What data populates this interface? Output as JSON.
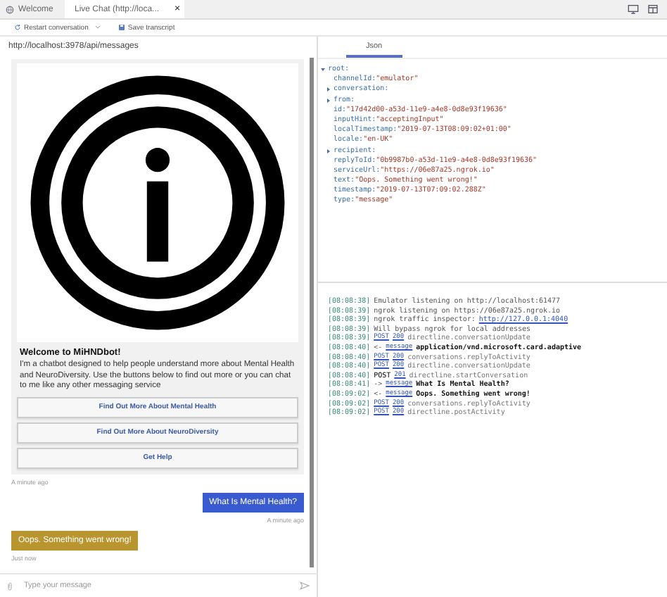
{
  "tabs": [
    {
      "label": "Welcome",
      "selected": false,
      "closable": false
    },
    {
      "label": "Live Chat (http://loca...",
      "selected": true,
      "closable": true
    }
  ],
  "tab_close": "×",
  "toolbar": {
    "restart": "Restart conversation",
    "save": "Save transcript"
  },
  "chat": {
    "url": "http://localhost:3978/api/messages",
    "card": {
      "title": "Welcome to MiHNDbot!",
      "text": "I'm a chatbot designed to help people understand more about Mental Health and NeuroDiversity. Use the buttons below to find out more or you can chat to me like any other messaging service",
      "buttons": [
        "Find Out More About Mental Health",
        "Find Out More About NeuroDiversity",
        "Get Help"
      ],
      "time": "A minute ago"
    },
    "messages": [
      {
        "kind": "sent",
        "text": "What Is Mental Health?",
        "time": "A minute ago"
      },
      {
        "kind": "received",
        "text": "Oops. Something went wrong!",
        "time": "Just now"
      }
    ],
    "input": {
      "placeholder": "Type your message"
    }
  },
  "inspector": {
    "tabs": [
      {
        "label": "Json",
        "selected": true
      }
    ],
    "tree": [
      {
        "key": "root:",
        "expanded": true,
        "children": [
          {
            "key": "channelId:",
            "value": "\"emulator\""
          },
          {
            "key": "conversation:",
            "expanded": false
          },
          {
            "key": "from:",
            "expanded": false
          },
          {
            "key": "id:",
            "value": "\"17d42d00-a53d-11e9-a4e8-0d8e93f19636\""
          },
          {
            "key": "inputHint:",
            "value": "\"acceptingInput\""
          },
          {
            "key": "localTimestamp:",
            "value": "\"2019-07-13T08:09:02+01:00\""
          },
          {
            "key": "locale:",
            "value": "\"en-UK\""
          },
          {
            "key": "recipient:",
            "expanded": false
          },
          {
            "key": "replyToId:",
            "value": "\"0b9987b0-a53d-11e9-a4e8-0d8e93f19636\""
          },
          {
            "key": "serviceUrl:",
            "value": "\"https://06e87a25.ngrok.io\""
          },
          {
            "key": "text:",
            "value": "\"Oops. Something went wrong!\""
          },
          {
            "key": "timestamp:",
            "value": "\"2019-07-13T07:09:02.288Z\""
          },
          {
            "key": "type:",
            "value": "\"message\""
          }
        ]
      }
    ]
  },
  "log": [
    {
      "time": "[08:08:38]",
      "kind": "plain",
      "text": "Emulator listening on http://localhost:61477"
    },
    {
      "time": "[08:08:39]",
      "kind": "plain",
      "text": "ngrok listening on https://06e87a25.ngrok.io"
    },
    {
      "time": "[08:08:39]",
      "kind": "plain",
      "text": "ngrok traffic inspector:",
      "link": "http://127.0.0.1:4040"
    },
    {
      "time": "[08:08:39]",
      "kind": "plain",
      "text": "Will bypass ngrok for local addresses"
    },
    {
      "time": "[08:08:39]",
      "kind": "request",
      "method": "POST",
      "method_linked": true,
      "status": "200",
      "text": "directline.conversationUpdate"
    },
    {
      "time": "[08:08:40]",
      "kind": "message",
      "arrow": "<-",
      "label": "message",
      "text": "application/vnd.microsoft.card.adaptive"
    },
    {
      "time": "[08:08:40]",
      "kind": "request",
      "method": "POST",
      "method_linked": true,
      "status": "200",
      "text": "conversations.replyToActivity"
    },
    {
      "time": "[08:08:40]",
      "kind": "request",
      "method": "POST",
      "method_linked": true,
      "status": "200",
      "text": "directline.conversationUpdate"
    },
    {
      "time": "[08:08:40]",
      "kind": "request",
      "method": "POST",
      "method_linked": false,
      "status": "201",
      "text": "directline.startConversation"
    },
    {
      "time": "[08:08:41]",
      "kind": "message",
      "arrow": "->",
      "label": "message",
      "text": "What Is Mental Health?"
    },
    {
      "time": "[08:09:02]",
      "kind": "message",
      "arrow": "<-",
      "label": "message",
      "text": "Oops. Something went wrong!"
    },
    {
      "time": "[08:09:02]",
      "kind": "request",
      "method": "POST",
      "method_linked": true,
      "status": "200",
      "text": "conversations.replyToActivity"
    },
    {
      "time": "[08:09:02]",
      "kind": "request",
      "method": "POST",
      "method_linked": true,
      "status": "200",
      "text": "directline.postActivity"
    }
  ]
}
